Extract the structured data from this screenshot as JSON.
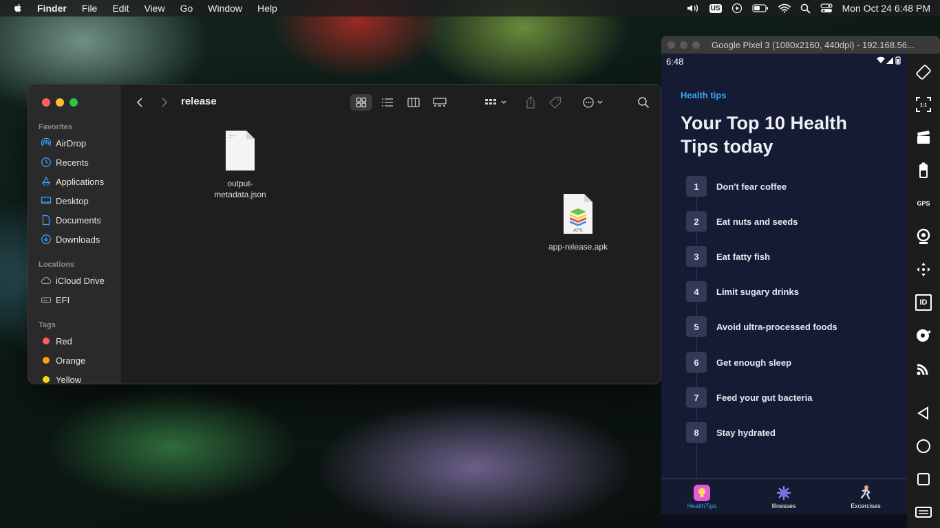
{
  "menubar": {
    "app": "Finder",
    "items": [
      "File",
      "Edit",
      "View",
      "Go",
      "Window",
      "Help"
    ],
    "input_source": "US",
    "clock": "Mon Oct 24  6:48 PM"
  },
  "finder": {
    "title": "release",
    "sidebar": {
      "favorites_header": "Favorites",
      "favorites": [
        {
          "label": "AirDrop",
          "icon": "airdrop-icon"
        },
        {
          "label": "Recents",
          "icon": "clock-icon"
        },
        {
          "label": "Applications",
          "icon": "applications-icon"
        },
        {
          "label": "Desktop",
          "icon": "desktop-icon"
        },
        {
          "label": "Documents",
          "icon": "document-icon"
        },
        {
          "label": "Downloads",
          "icon": "download-icon"
        }
      ],
      "locations_header": "Locations",
      "locations": [
        {
          "label": "iCloud Drive",
          "icon": "cloud-icon"
        },
        {
          "label": "EFI",
          "icon": "drive-icon"
        }
      ],
      "tags_header": "Tags",
      "tags": [
        {
          "label": "Red",
          "color": "#ff5f57"
        },
        {
          "label": "Orange",
          "color": "#ff9f0a"
        },
        {
          "label": "Yellow",
          "color": "#ffd60a"
        }
      ]
    },
    "files": [
      {
        "name": "output-metadata.json",
        "name_line1": "output-",
        "name_line2": "metadata.json",
        "icon": "json-file-icon"
      },
      {
        "name": "app-release.apk",
        "icon": "apk-file-icon",
        "badge": "APK"
      }
    ]
  },
  "emulator": {
    "title": "Google Pixel 3 (1080x2160, 440dpi) - 192.168.56...",
    "status_time": "6:48",
    "app": {
      "subtitle": "Health tips",
      "title": "Your Top 10 Health Tips today",
      "tips": [
        {
          "num": "1",
          "text": "Don't fear coffee"
        },
        {
          "num": "2",
          "text": "Eat nuts and seeds"
        },
        {
          "num": "3",
          "text": "Eat fatty fish"
        },
        {
          "num": "4",
          "text": "Limit sugary drinks"
        },
        {
          "num": "5",
          "text": "Avoid ultra-processed foods"
        },
        {
          "num": "6",
          "text": "Get enough sleep"
        },
        {
          "num": "7",
          "text": "Feed your gut bacteria"
        },
        {
          "num": "8",
          "text": "Stay hydrated"
        }
      ],
      "nav": [
        {
          "label": "HealthTips",
          "active": true
        },
        {
          "label": "Illnesses",
          "active": false
        },
        {
          "label": "Excercises",
          "active": false
        }
      ]
    },
    "side_tools": [
      "rotate-icon",
      "one-to-one-icon",
      "clapper-icon",
      "battery-icon",
      "gps-icon",
      "camera-icon",
      "move-icon",
      "id-icon",
      "disc-icon",
      "cast-icon",
      "back-icon",
      "home-icon",
      "recents-icon",
      "menu-icon"
    ],
    "side_labels": {
      "one_to_one": "1:1",
      "gps": "GPS",
      "id": "ID"
    },
    "colors": {
      "accent": "#35a9f5",
      "phone_bg": "#151b33"
    }
  }
}
